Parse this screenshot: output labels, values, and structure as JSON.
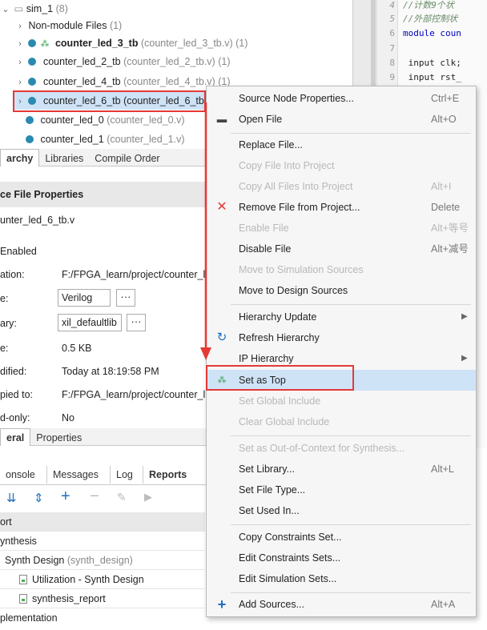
{
  "tree": {
    "root": {
      "label": "sim_1",
      "count": "(8)"
    },
    "items": [
      {
        "name": "Non-module Files",
        "file": "",
        "count": "(1)"
      },
      {
        "name": "counter_led_3_tb",
        "file": "(counter_led_3_tb.v)",
        "count": "(1)"
      },
      {
        "name": "counter_led_2_tb",
        "file": "(counter_led_2_tb.v)",
        "count": "(1)"
      },
      {
        "name": "counter_led_4_tb",
        "file": "(counter_led_4_tb.v)",
        "count": "(1)"
      },
      {
        "name": "counter_led_6_tb",
        "file": "(counter_led_6_tb.v)",
        "count": ""
      },
      {
        "name": "counter_led_0",
        "file": "(counter_led_0.v)",
        "count": ""
      },
      {
        "name": "counter_led_1",
        "file": "(counter_led_1.v)",
        "count": ""
      }
    ]
  },
  "tabs1": [
    "archy",
    "Libraries",
    "Compile Order"
  ],
  "props": {
    "title": "ce File Properties",
    "filename": "unter_led_6_tb.v",
    "enabled": "Enabled",
    "location_lbl": "ation:",
    "location_val": "F:/FPGA_learn/project/counter_l",
    "type_lbl": "e:",
    "type_val": "Verilog",
    "library_lbl": "ary:",
    "library_val": "xil_defaultlib",
    "size_lbl": "e:",
    "size_val": "0.5 KB",
    "modified_lbl": "dified:",
    "modified_val": "Today at 18:19:58 PM",
    "copied_lbl": "pied to:",
    "copied_val": "F:/FPGA_learn/project/counter_l",
    "readonly_lbl": "d-only:",
    "readonly_val": "No",
    "dots": "···"
  },
  "tabs2": [
    "eral",
    "Properties"
  ],
  "tabs3": [
    "onsole",
    "Messages",
    "Log",
    "Reports"
  ],
  "reports": {
    "header": "ort",
    "rows": [
      "ynthesis",
      "Synth Design",
      "Utilization - Synth Design",
      "synthesis_report",
      "plementation"
    ],
    "synth_design_suffix": "(synth_design)"
  },
  "code": {
    "lines": [
      {
        "n": "4",
        "t": "//计数9个状"
      },
      {
        "n": "5",
        "t": "//外部控制状"
      },
      {
        "n": "6",
        "t": "module coun"
      },
      {
        "n": "7",
        "t": ""
      },
      {
        "n": "8",
        "t": "  input clk;"
      },
      {
        "n": "9",
        "t": "  input rst_"
      }
    ]
  },
  "menu": {
    "items": [
      {
        "label": "Source Node Properties...",
        "shortcut": "Ctrl+E",
        "disabled": false
      },
      {
        "label": "Open File",
        "shortcut": "Alt+O",
        "disabled": false
      },
      {
        "label": "Replace File...",
        "shortcut": "",
        "disabled": false
      },
      {
        "label": "Copy File Into Project",
        "shortcut": "",
        "disabled": true
      },
      {
        "label": "Copy All Files Into Project",
        "shortcut": "Alt+I",
        "disabled": true
      },
      {
        "label": "Remove File from Project...",
        "shortcut": "Delete",
        "disabled": false
      },
      {
        "label": "Enable File",
        "shortcut": "Alt+等号",
        "disabled": true
      },
      {
        "label": "Disable File",
        "shortcut": "Alt+减号",
        "disabled": false
      },
      {
        "label": "Move to Simulation Sources",
        "shortcut": "",
        "disabled": true
      },
      {
        "label": "Move to Design Sources",
        "shortcut": "",
        "disabled": false
      },
      {
        "label": "Hierarchy Update",
        "shortcut": "",
        "disabled": false
      },
      {
        "label": "Refresh Hierarchy",
        "shortcut": "",
        "disabled": false
      },
      {
        "label": "IP Hierarchy",
        "shortcut": "",
        "disabled": false
      },
      {
        "label": "Set as Top",
        "shortcut": "",
        "disabled": false
      },
      {
        "label": "Set Global Include",
        "shortcut": "",
        "disabled": true
      },
      {
        "label": "Clear Global Include",
        "shortcut": "",
        "disabled": true
      },
      {
        "label": "Set as Out-of-Context for Synthesis...",
        "shortcut": "",
        "disabled": true
      },
      {
        "label": "Set Library...",
        "shortcut": "Alt+L",
        "disabled": false
      },
      {
        "label": "Set File Type...",
        "shortcut": "",
        "disabled": false
      },
      {
        "label": "Set Used In...",
        "shortcut": "",
        "disabled": false
      },
      {
        "label": "Copy Constraints Set...",
        "shortcut": "",
        "disabled": false
      },
      {
        "label": "Edit Constraints Sets...",
        "shortcut": "",
        "disabled": false
      },
      {
        "label": "Edit Simulation Sets...",
        "shortcut": "",
        "disabled": false
      },
      {
        "label": "Add Sources...",
        "shortcut": "Alt+A",
        "disabled": false
      }
    ]
  },
  "colors": {
    "highlight": "#cfe3f7",
    "red": "#e53935",
    "accent": "#1e6fc0"
  }
}
